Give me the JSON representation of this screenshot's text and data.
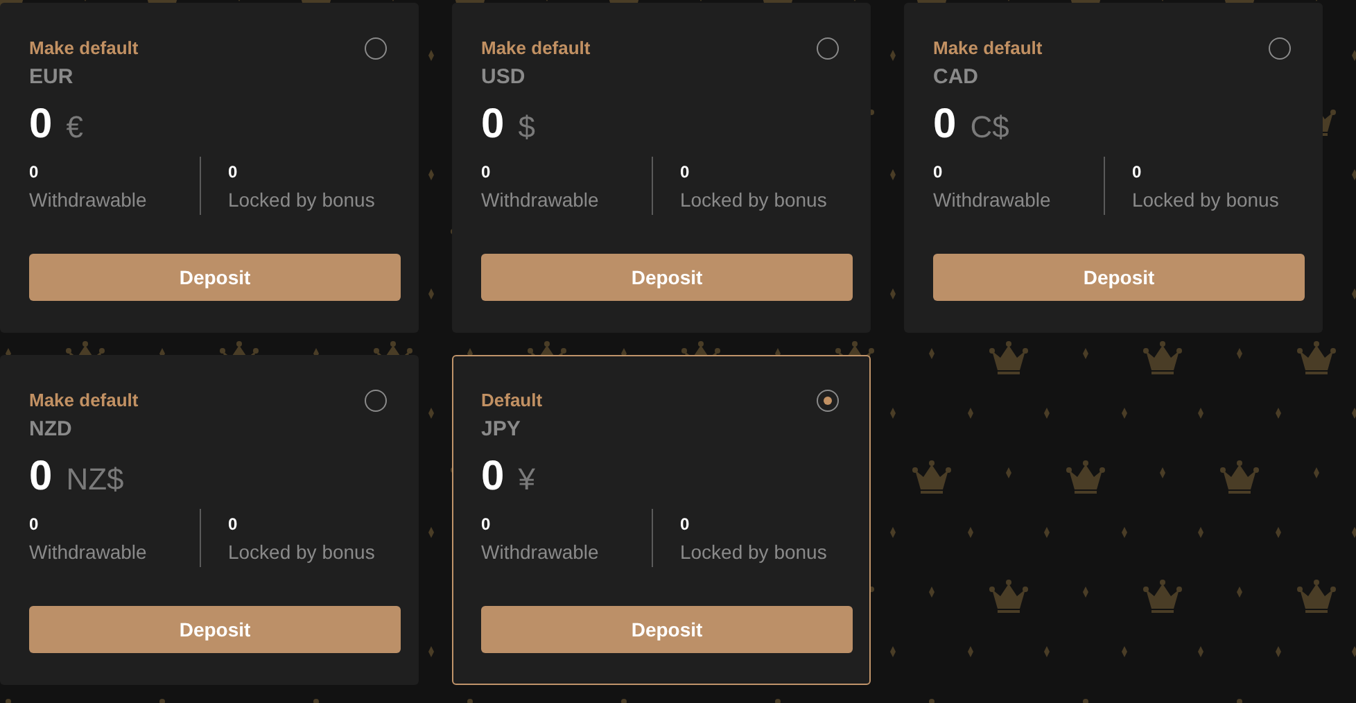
{
  "wallets": [
    {
      "default_label": "Make default",
      "selected": false,
      "currency": "EUR",
      "amount": "0",
      "symbol": "€",
      "withdrawable_value": "0",
      "withdrawable_label": "Withdrawable",
      "locked_value": "0",
      "locked_label": "Locked by bonus",
      "button": "Deposit"
    },
    {
      "default_label": "Make default",
      "selected": false,
      "currency": "USD",
      "amount": "0",
      "symbol": "$",
      "withdrawable_value": "0",
      "withdrawable_label": "Withdrawable",
      "locked_value": "0",
      "locked_label": "Locked by bonus",
      "button": "Deposit"
    },
    {
      "default_label": "Make default",
      "selected": false,
      "currency": "CAD",
      "amount": "0",
      "symbol": "C$",
      "withdrawable_value": "0",
      "withdrawable_label": "Withdrawable",
      "locked_value": "0",
      "locked_label": "Locked by bonus",
      "button": "Deposit"
    },
    {
      "default_label": "Make default",
      "selected": false,
      "currency": "NZD",
      "amount": "0",
      "symbol": "NZ$",
      "withdrawable_value": "0",
      "withdrawable_label": "Withdrawable",
      "locked_value": "0",
      "locked_label": "Locked by bonus",
      "button": "Deposit"
    },
    {
      "default_label": "Default",
      "selected": true,
      "currency": "JPY",
      "amount": "0",
      "symbol": "¥",
      "withdrawable_value": "0",
      "withdrawable_label": "Withdrawable",
      "locked_value": "0",
      "locked_label": "Locked by bonus",
      "button": "Deposit"
    }
  ]
}
